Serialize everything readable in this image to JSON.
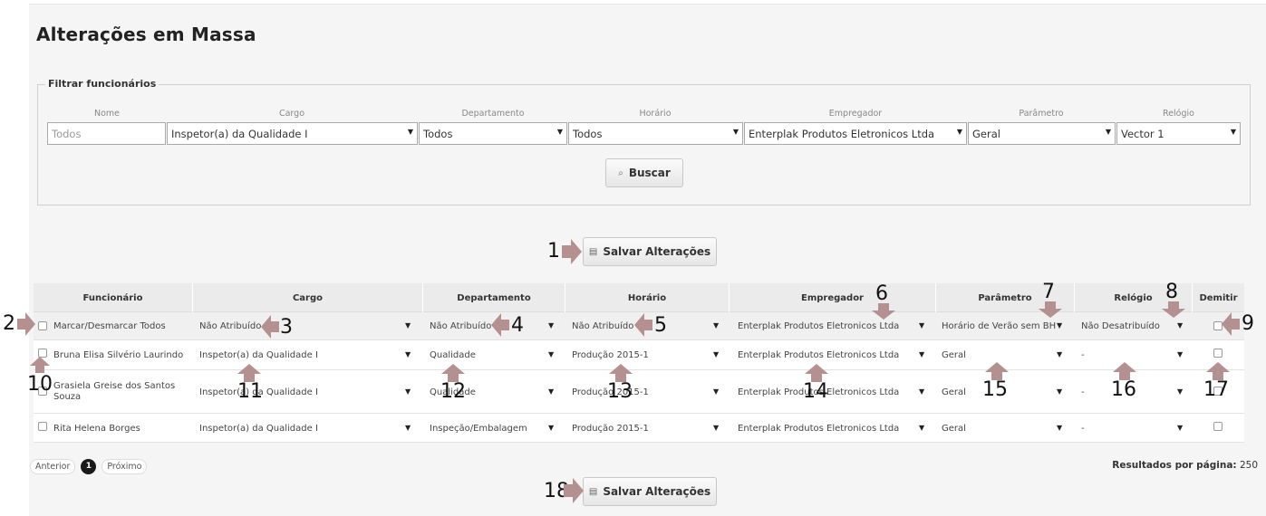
{
  "page": {
    "title": "Alterações em Massa"
  },
  "filter": {
    "legend": "Filtrar funcionários",
    "labels": {
      "nome": "Nome",
      "cargo": "Cargo",
      "departamento": "Departamento",
      "horario": "Horário",
      "empregador": "Empregador",
      "parametro": "Parâmetro",
      "relogio": "Relógio"
    },
    "nome_placeholder": "Todos",
    "cargo": "Inspetor(a) da Qualidade I",
    "departamento": "Todos",
    "horario": "Todos",
    "empregador": "Enterplak Produtos Eletronicos Ltda",
    "parametro": "Geral",
    "relogio": "Vector 1",
    "search_button": "Buscar"
  },
  "save_button": "Salvar Alterações",
  "table": {
    "headers": {
      "funcionario": "Funcionário",
      "cargo": "Cargo",
      "departamento": "Departamento",
      "horario": "Horário",
      "empregador": "Empregador",
      "parametro": "Parâmetro",
      "relogio": "Relógio",
      "demitir": "Demitir"
    },
    "master_row": {
      "label": "Marcar/Desmarcar Todos",
      "cargo": "Não Atribuído",
      "departamento": "Não Atribuído",
      "horario": "Não Atribuído",
      "empregador": "Enterplak Produtos Eletronicos Ltda",
      "parametro": "Horário de Verão sem BH",
      "relogio": "Não Desatribuído"
    },
    "rows": [
      {
        "funcionario": "Bruna Elisa Silvério Laurindo",
        "cargo": "Inspetor(a) da Qualidade I",
        "departamento": "Qualidade",
        "horario": "Produção 2015-1",
        "empregador": "Enterplak Produtos Eletronicos Ltda",
        "parametro": "Geral",
        "relogio": "-"
      },
      {
        "funcionario": "Grasiela Greise dos Santos Souza",
        "cargo": "Inspetor(a) da Qualidade I",
        "departamento": "Qualidade",
        "horario": "Produção 2015-1",
        "empregador": "Enterplak Produtos Eletronicos Ltda",
        "parametro": "Geral",
        "relogio": "-"
      },
      {
        "funcionario": "Rita Helena Borges",
        "cargo": "Inspetor(a) da Qualidade I",
        "departamento": "Inspeção/Embalagem",
        "horario": "Produção 2015-1",
        "empregador": "Enterplak Produtos Eletronicos Ltda",
        "parametro": "Geral",
        "relogio": "-"
      }
    ]
  },
  "pagination": {
    "prev": "Anterior",
    "current": "1",
    "next": "Próximo",
    "per_page_label": "Resultados por página:",
    "per_page_value": "250"
  },
  "annotations": [
    "1",
    "2",
    "3",
    "4",
    "5",
    "6",
    "7",
    "8",
    "9",
    "10",
    "11",
    "12",
    "13",
    "14",
    "15",
    "16",
    "17",
    "18"
  ],
  "colors": {
    "annotation_arrow": "#b59090",
    "header_bg": "#ebebeb",
    "page_bg": "#f5f5f5"
  }
}
